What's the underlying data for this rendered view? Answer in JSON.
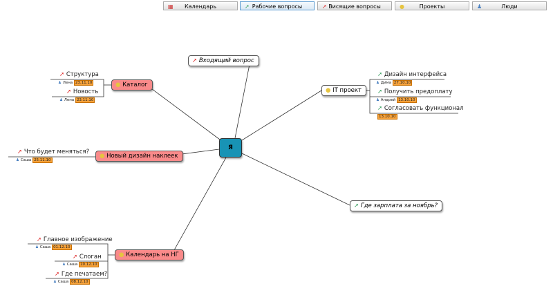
{
  "toolbar": [
    {
      "label": "Календарь",
      "icon": "calendar-icon"
    },
    {
      "label": "Рабочие вопросы",
      "icon": "green-pin-icon",
      "active": true
    },
    {
      "label": "Висящие вопросы",
      "icon": "red-pin-icon"
    },
    {
      "label": "Проекты",
      "icon": "lightbulb-icon"
    },
    {
      "label": "Люди",
      "icon": "user-icon"
    }
  ],
  "center": {
    "label": "Я",
    "color": "#1893b5"
  },
  "nodes": {
    "incoming": "Входящий вопрос",
    "catalog": "Каталог",
    "sticker": "Новый дизайн наклеек",
    "it": "IT проект",
    "salary": "Где зарплата за ноябрь?",
    "calendar": "Календарь на НГ"
  },
  "leaves": {
    "structure": {
      "text": "Структура",
      "person": "Лена",
      "date": "23.11.10"
    },
    "news": {
      "text": "Новость",
      "person": "Лена",
      "date": "23.11.10"
    },
    "change": {
      "text": "Что будет меняться?",
      "person": "Саша",
      "date": "25.11.10"
    },
    "design": {
      "text": "Дизайн интерфейса",
      "person": "Дима",
      "date": "27.10.10"
    },
    "prepay": {
      "text": "Получить предоплату",
      "person": "Андрей",
      "date": "13.10.10"
    },
    "func": {
      "text": "Согласовать функционал",
      "date": "13.10.10"
    },
    "image": {
      "text": "Главное изображение",
      "person": "Саша",
      "date": "01.12.10"
    },
    "slogan": {
      "text": "Слоган",
      "person": "Саша",
      "date": "10.12.10"
    },
    "print": {
      "text": "Где печатаем?",
      "person": "Саша",
      "date": "08.12.10"
    }
  },
  "colors": {
    "project": "#f98a8a",
    "center": "#1893b5",
    "date": "#f7a23a"
  }
}
